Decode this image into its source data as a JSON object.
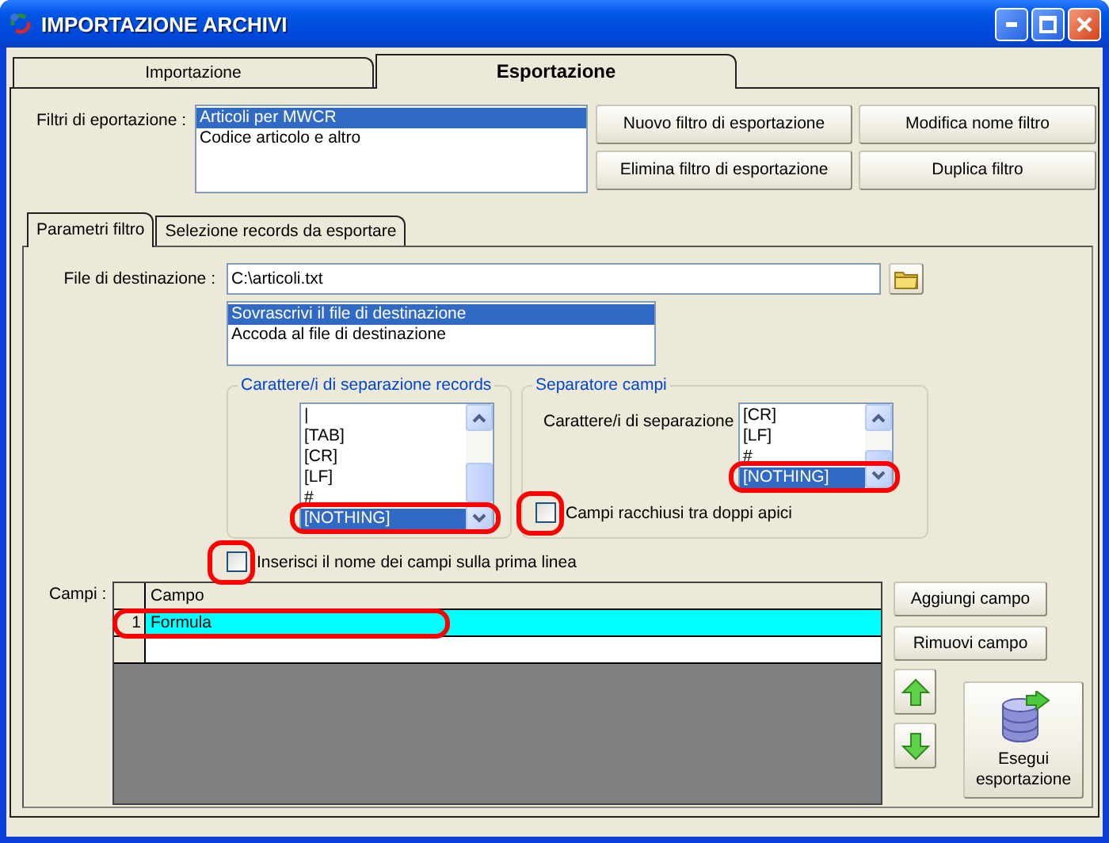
{
  "window": {
    "title": "IMPORTAZIONE ARCHIVI"
  },
  "tabs": [
    {
      "label": "Importazione",
      "selected": false
    },
    {
      "label": "Esportazione",
      "selected": true
    }
  ],
  "export_filters": {
    "label": "Filtri di eportazione :",
    "items": [
      {
        "text": "Articoli per MWCR",
        "selected": true
      },
      {
        "text": "Codice articolo e altro",
        "selected": false
      }
    ]
  },
  "filter_buttons": [
    "Nuovo filtro di esportazione",
    "Modifica nome filtro",
    "Elimina filtro di esportazione",
    "Duplica filtro"
  ],
  "subtabs": [
    {
      "label": "Parametri filtro",
      "selected": true
    },
    {
      "label": "Selezione records da esportare",
      "selected": false
    }
  ],
  "destination": {
    "label": "File di destinazione :",
    "value": "C:\\articoli.txt"
  },
  "write_mode": {
    "items": [
      {
        "text": "Sovrascrivi il file di destinazione",
        "selected": true
      },
      {
        "text": "Accoda al file di destinazione",
        "selected": false
      }
    ]
  },
  "record_separator": {
    "title": "Carattere/i di separazione records",
    "items": [
      {
        "text": "|",
        "selected": false,
        "annotated": false
      },
      {
        "text": "[TAB]",
        "selected": false,
        "annotated": false
      },
      {
        "text": "[CR]",
        "selected": false,
        "annotated": false
      },
      {
        "text": "[LF]",
        "selected": false,
        "annotated": false
      },
      {
        "text": "#",
        "selected": false,
        "annotated": false
      },
      {
        "text": "[NOTHING]",
        "selected": true,
        "annotated": true
      }
    ]
  },
  "field_separator": {
    "title": "Separatore campi",
    "label": "Carattere/i di separazione",
    "items": [
      {
        "text": "[CR]",
        "selected": false,
        "annotated": false
      },
      {
        "text": "[LF]",
        "selected": false,
        "annotated": false
      },
      {
        "text": "#",
        "selected": false,
        "annotated": false
      },
      {
        "text": "[NOTHING]",
        "selected": true,
        "annotated": true
      }
    ],
    "quoted": {
      "label": "Campi racchiusi tra doppi apici",
      "checked": false,
      "annotated": true
    }
  },
  "header_checkbox": {
    "label": "Inserisci il nome dei campi sulla prima linea",
    "checked": false,
    "annotated": true
  },
  "fields": {
    "label": "Campi :",
    "columns": [
      "Campo"
    ],
    "rows": [
      {
        "number": "1",
        "cells": [
          "Formula"
        ],
        "selected": true,
        "annotated": true
      }
    ]
  },
  "field_buttons": [
    "Aggiungi campo",
    "Rimuovi campo"
  ],
  "run_button": {
    "label": "Esegui esportazione"
  }
}
